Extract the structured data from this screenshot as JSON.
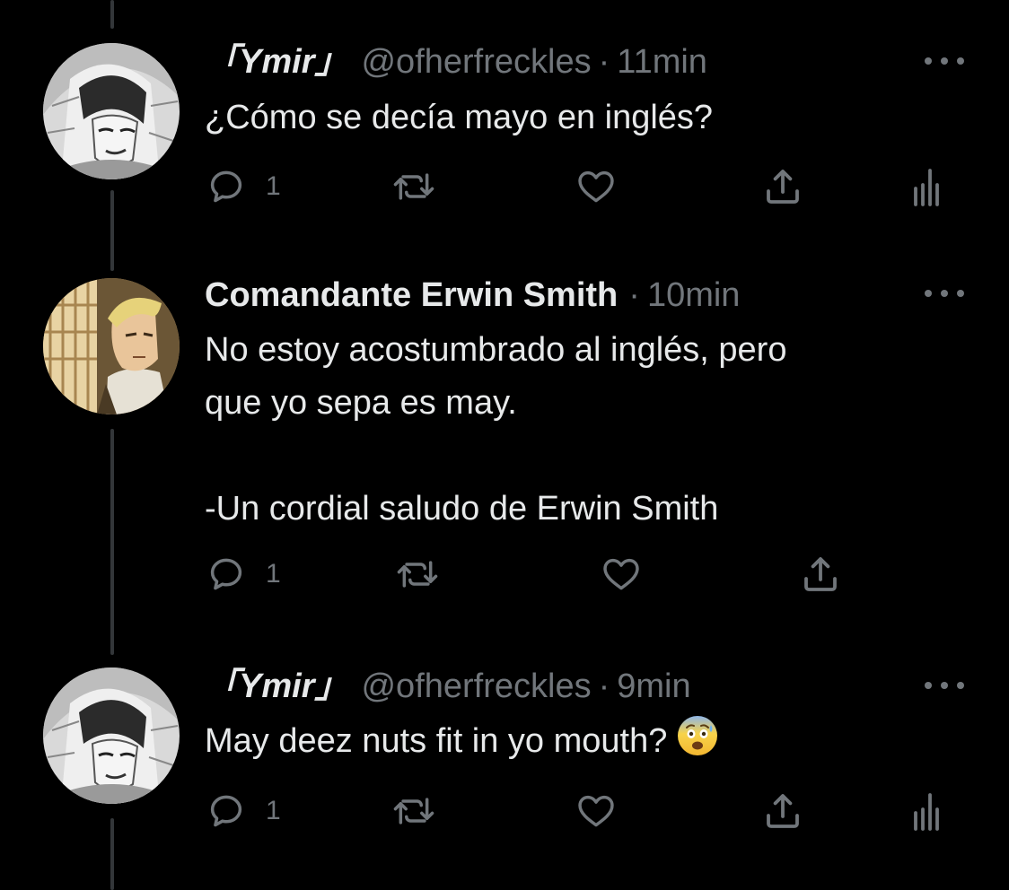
{
  "colors": {
    "background": "#000000",
    "text_primary": "#e7e9ea",
    "text_secondary": "#71767b",
    "thread_line": "#333639"
  },
  "icons": {
    "reply": "reply-icon",
    "retweet": "retweet-icon",
    "like": "heart-icon",
    "share": "share-icon",
    "analytics": "analytics-icon",
    "more": "more-options-icon"
  },
  "tweets": [
    {
      "name": "「Ymir」",
      "handle": "@ofherfreckles",
      "separator": "·",
      "time": "11min",
      "lines": [
        "¿Cómo se decía mayo en inglés?"
      ],
      "reply_count": "1"
    },
    {
      "name": "Comandante Erwin Smith",
      "separator": "·",
      "time": "10min",
      "lines": [
        "No estoy acostumbrado al inglés, pero",
        "que yo sepa es may.",
        "-Un cordial saludo de Erwin Smith"
      ],
      "reply_count": "1"
    },
    {
      "name": "「Ymir」",
      "handle": "@ofherfreckles",
      "separator": "·",
      "time": "9min",
      "lines": [
        "May deez nuts fit in yo mouth?"
      ],
      "emoji": "anxious-face-with-sweat",
      "reply_count": "1"
    }
  ]
}
